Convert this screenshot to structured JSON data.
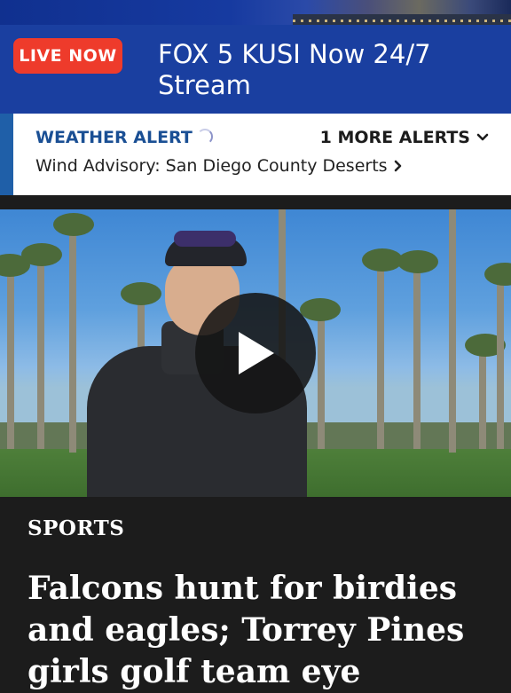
{
  "live_banner": {
    "badge": "LIVE NOW",
    "title": "FOX 5 KUSI Now 24/7 Stream"
  },
  "weather_alert": {
    "heading": "WEATHER ALERT",
    "more_alerts": "1 MORE ALERTS",
    "message": "Wind Advisory: San Diego County Deserts"
  },
  "article": {
    "category": "SPORTS",
    "headline": "Falcons hunt for birdies and eagles; Torrey Pines girls golf team eye"
  },
  "icons": {
    "play": "play-icon",
    "chevron_down": "chevron-down-icon",
    "chevron_right": "chevron-right-icon",
    "spinner": "loading-spinner-icon"
  },
  "colors": {
    "live_bar": "#1a3fa0",
    "live_badge": "#ee3b2b",
    "alert_accent": "#1f5fa8",
    "alert_heading": "#1a4f94",
    "page_background": "#1c1c1c"
  }
}
